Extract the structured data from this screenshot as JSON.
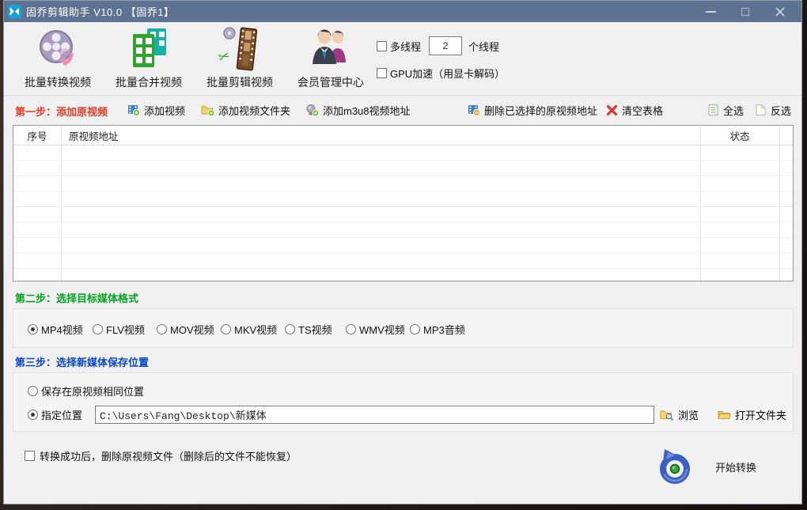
{
  "window": {
    "title": "固乔剪辑助手 V10.0 【固乔1】",
    "titlebar_color": "#5d7391",
    "app_icon": "blue-film-cutter-icon",
    "controls": [
      "minimize",
      "maximize",
      "close"
    ]
  },
  "toolbar": {
    "items": [
      {
        "label": "批量转换视频",
        "icon": "film-reel-icon"
      },
      {
        "label": "批量合并视频",
        "icon": "merge-filmstrips-icon"
      },
      {
        "label": "批量剪辑视频",
        "icon": "cut-filmstrip-icon"
      },
      {
        "label": "会员管理中心",
        "icon": "members-people-icon"
      }
    ],
    "thread": {
      "label": "多线程",
      "value": "2",
      "suffix": "个线程",
      "checked": false
    },
    "gpu": {
      "label": "GPU加速（用显卡解码）",
      "checked": false
    }
  },
  "step1": {
    "title": "第一步：添加原视频",
    "title_color": "#ea3b25",
    "add_video": {
      "label": "添加视频",
      "icon": "film-add-icon"
    },
    "add_folder": {
      "label": "添加视频文件夹",
      "icon": "folder-add-icon"
    },
    "add_m3u8": {
      "label": "添加m3u8视频地址",
      "icon": "url-add-icon"
    },
    "delete_selected": {
      "label": "删除已选择的原视频地址",
      "icon": "film-remove-icon"
    },
    "clear_table": {
      "label": "清空表格",
      "icon": "red-x-icon"
    },
    "select_all": {
      "label": "全选",
      "icon": "document-lines-icon"
    },
    "invert_selection": {
      "label": "反选",
      "icon": "document-blank-icon"
    },
    "table": {
      "columns": [
        "序号",
        "原视频地址",
        "状态"
      ],
      "rows": []
    }
  },
  "step2": {
    "title": "第二步：选择目标媒体格式",
    "title_color": "#00a41e",
    "options": [
      {
        "label": "MP4视频",
        "checked": true
      },
      {
        "label": "FLV视频",
        "checked": false
      },
      {
        "label": "MOV视频",
        "checked": false
      },
      {
        "label": "MKV视频",
        "checked": false
      },
      {
        "label": "TS视频",
        "checked": false
      },
      {
        "label": "WMV视频",
        "checked": false
      },
      {
        "label": "MP3音频",
        "checked": false
      }
    ]
  },
  "step3": {
    "title": "第三步：选择新媒体保存位置",
    "title_color": "#0645d2",
    "same_location": {
      "label": "保存在原视频相同位置",
      "checked": false
    },
    "custom_location": {
      "label": "指定位置",
      "checked": true
    },
    "path_value": "C:\\Users\\Fang\\Desktop\\新媒体",
    "browse": {
      "label": "浏览",
      "icon": "folder-search-icon"
    },
    "open_folder": {
      "label": "打开文件夹",
      "icon": "open-folder-icon"
    }
  },
  "footer": {
    "delete_after": {
      "label": "转换成功后，删除原视频文件（删除后的文件不能恢复）",
      "checked": false
    },
    "start": {
      "label": "开始转换",
      "icon": "blue-circular-arrow-icon"
    }
  }
}
